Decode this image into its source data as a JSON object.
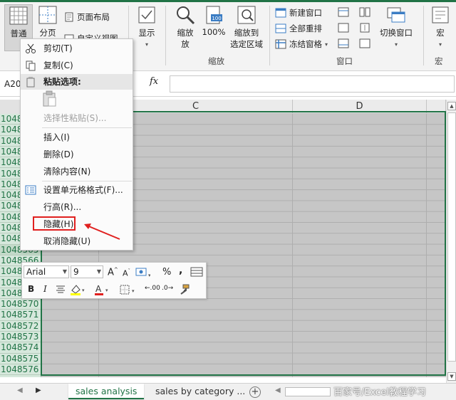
{
  "ribbon": {
    "view_normal": "普通",
    "view_pagebreak": "分页",
    "view_pagelayout": "页面布局",
    "view_custom": "自定义视图",
    "show": "显示",
    "zoom": "缩放",
    "zoom_label_2": "放",
    "zoom_100": "100%",
    "zoom_selection_1": "缩放到",
    "zoom_selection_2": "选定区域",
    "group_zoom": "缩放",
    "new_window": "新建窗口",
    "arrange_all": "全部重排",
    "freeze_panes": "冻结窗格",
    "switch_windows": "切换窗口",
    "group_window": "窗口",
    "macros": "宏",
    "group_macros": "宏"
  },
  "formula_bar": {
    "name_box": "A20",
    "fx": "fx"
  },
  "columns": [
    "C",
    "D"
  ],
  "rows": [
    "1048",
    "1048",
    "1048",
    "1048",
    "1048",
    "1048",
    "1048",
    "1048",
    "1048",
    "1048",
    "1048",
    "1048",
    "1048565",
    "1048566",
    "1048567",
    "1048568",
    "1048569",
    "1048570",
    "1048571",
    "1048572",
    "1048573",
    "1048574",
    "1048575",
    "1048576"
  ],
  "context_menu": {
    "cut": "剪切(T)",
    "copy": "复制(C)",
    "paste_options": "粘贴选项:",
    "paste_special": "选择性粘贴(S)...",
    "insert": "插入(I)",
    "delete": "删除(D)",
    "clear": "清除内容(N)",
    "format_cells": "设置单元格格式(F)...",
    "row_height": "行高(R)...",
    "hide": "隐藏(H)",
    "unhide": "取消隐藏(U)"
  },
  "mini_toolbar": {
    "font": "Arial",
    "size": "9",
    "bold": "B",
    "italic": "I",
    "percent": "%",
    "comma": ",",
    "dec_inc": ".00",
    "dec_dec": ".0"
  },
  "tabs": {
    "active": "sales analysis",
    "other": "sales by category ..."
  },
  "watermark": "百家号/Excel教程学习",
  "colors": {
    "accent": "#217346",
    "highlight": "#e0201f",
    "grid": "#c6c6c6"
  }
}
